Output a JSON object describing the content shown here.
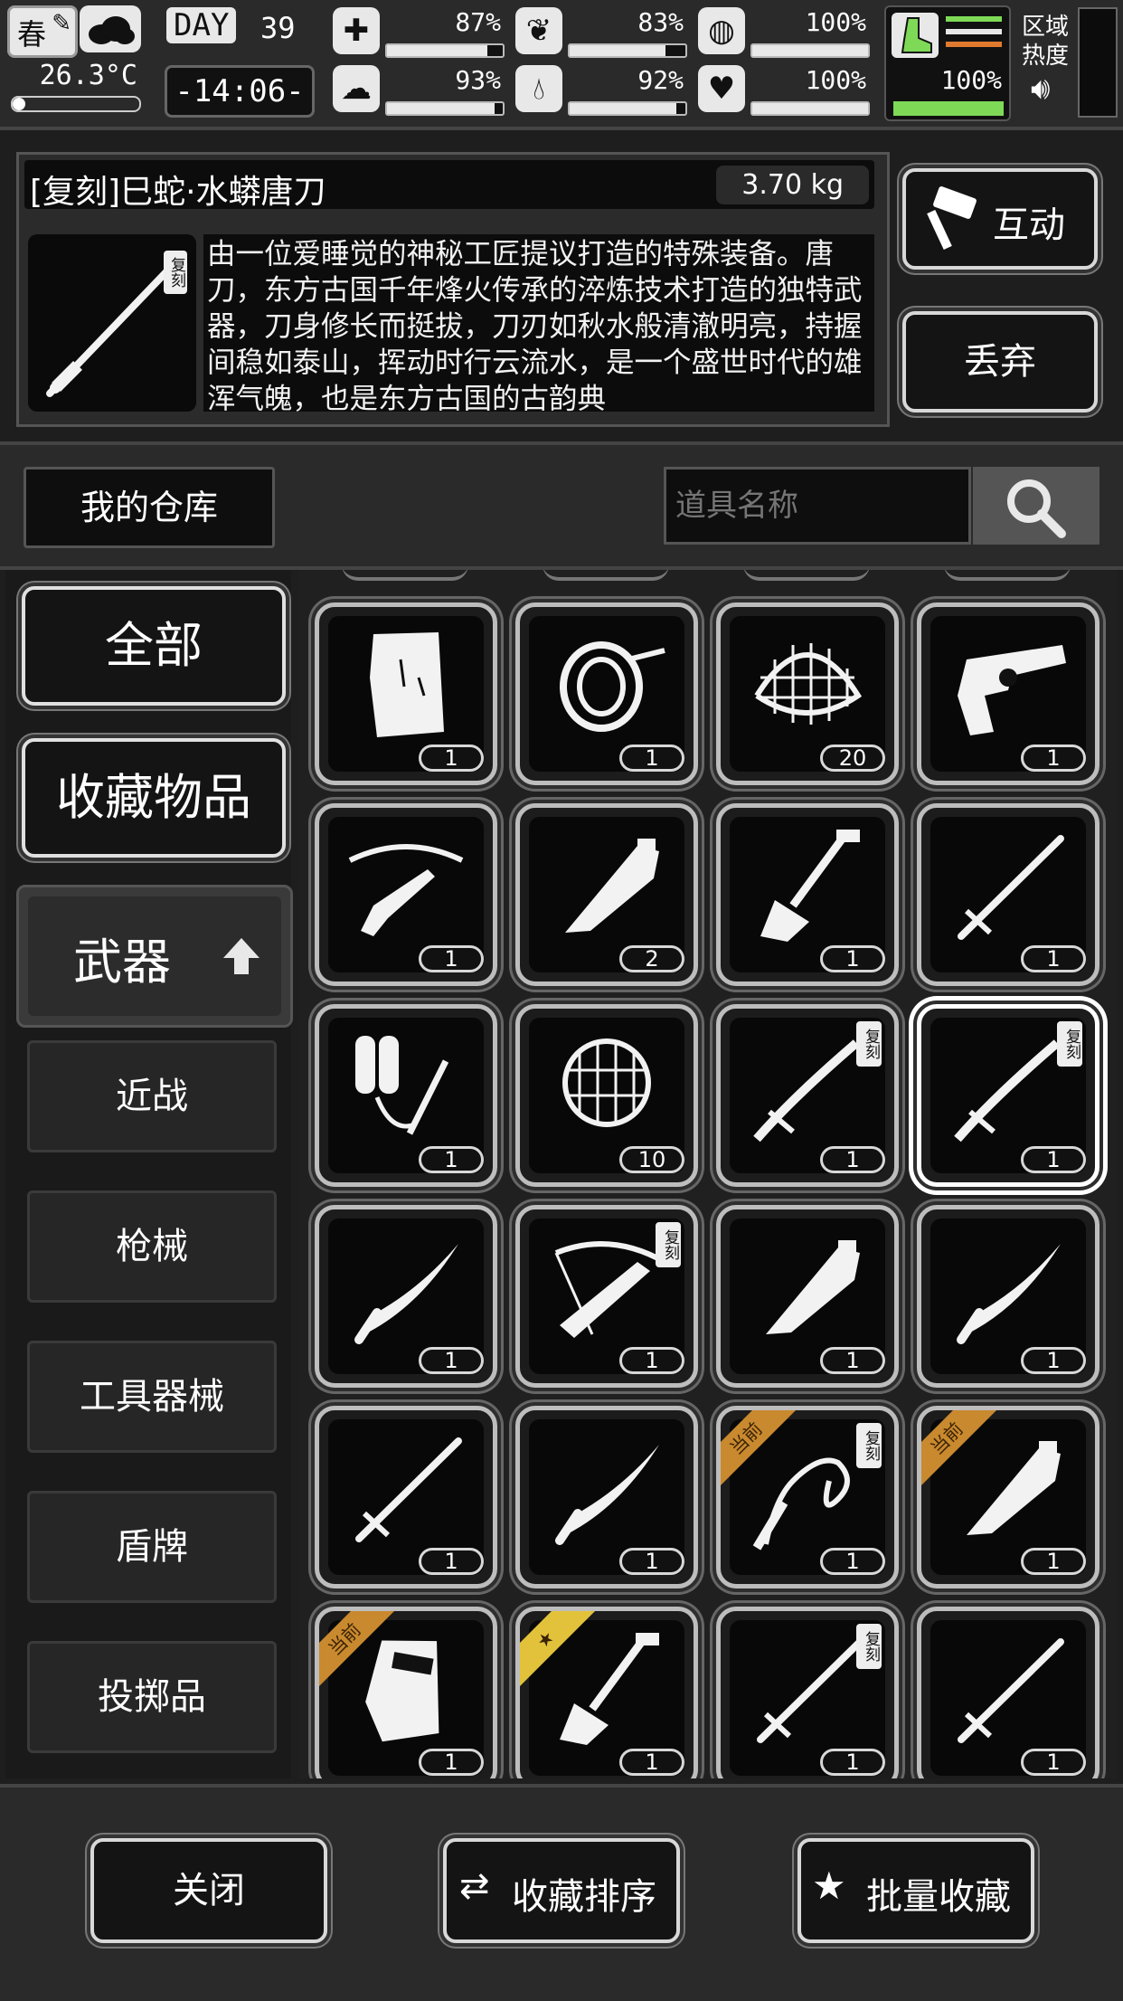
{
  "status": {
    "season": "春",
    "temperature": "26.3°C",
    "day_label": "DAY",
    "day_number": "39",
    "time": "-14:06-",
    "stats": [
      {
        "name": "health",
        "icon": "first-aid-kit-icon",
        "value": "87%",
        "level": 0.87
      },
      {
        "name": "hunger",
        "icon": "stomach-icon",
        "value": "83%",
        "level": 0.83
      },
      {
        "name": "stamina",
        "icon": "lung-icon",
        "value": "100%",
        "level": 1.0
      },
      {
        "name": "sanity",
        "icon": "brain-icon",
        "value": "93%",
        "level": 0.93
      },
      {
        "name": "thirst",
        "icon": "water-drop-icon",
        "value": "92%",
        "level": 0.92
      },
      {
        "name": "mood",
        "icon": "heart-icon",
        "value": "100%",
        "level": 1.0
      }
    ],
    "foot_value": "100%",
    "region_heat_label": "区域热度",
    "accent_green": "#7ed957",
    "accent_orange": "#e07a2e"
  },
  "item": {
    "name": "[复刻]巳蛇·水蟒唐刀",
    "weight": "3.70 kg",
    "tag": "复刻",
    "description": "由一位爱睡觉的神秘工匠提议打造的特殊装备。唐刀，东方古国千年烽火传承的淬炼技术打造的独特武器，刀身修长而挺拔，刀刃如秋水般清澈明亮，持握间稳如泰山，挥动时行云流水，是一个盛世时代的雄浑气魄，也是东方古国的古韵典",
    "interact_label": "互动",
    "discard_label": "丢弃"
  },
  "warehouse": {
    "title": "我的仓库",
    "search_placeholder": "道具名称"
  },
  "categories": {
    "all": "全部",
    "favorites": "收藏物品",
    "weapons": "武器",
    "sub": [
      "近战",
      "枪械",
      "工具器械",
      "盾牌",
      "投掷品"
    ]
  },
  "grid": [
    {
      "icon": "paper-map-icon",
      "count": "1"
    },
    {
      "icon": "rope-coil-icon",
      "count": "1"
    },
    {
      "icon": "fishing-net-icon",
      "count": "20"
    },
    {
      "icon": "revolver-icon",
      "count": "1"
    },
    {
      "icon": "crossbow-hand-icon",
      "count": "1"
    },
    {
      "icon": "machete-icon",
      "count": "2"
    },
    {
      "icon": "shovel-icon",
      "count": "1"
    },
    {
      "icon": "serrated-knife-icon",
      "count": "1"
    },
    {
      "icon": "flamethrower-icon",
      "count": "1"
    },
    {
      "icon": "net-bag-icon",
      "count": "10"
    },
    {
      "icon": "ornate-sword-icon",
      "count": "1",
      "tag": "复刻"
    },
    {
      "icon": "tang-dao-icon",
      "count": "1",
      "tag": "复刻",
      "selected": true
    },
    {
      "icon": "folding-knife-icon",
      "count": "1"
    },
    {
      "icon": "crossbow-icon",
      "count": "1",
      "tag": "复刻"
    },
    {
      "icon": "cleaver-icon",
      "count": "1"
    },
    {
      "icon": "curved-knife-icon",
      "count": "1"
    },
    {
      "icon": "machete-blade-icon",
      "count": "1"
    },
    {
      "icon": "sabre-icon",
      "count": "1"
    },
    {
      "icon": "whip-icon",
      "count": "1",
      "tag": "复刻",
      "ribbon": "当前"
    },
    {
      "icon": "meat-cleaver-icon",
      "count": "1",
      "ribbon": "当前"
    },
    {
      "icon": "riot-shield-icon",
      "count": "1",
      "ribbon": "当前"
    },
    {
      "icon": "spade-icon",
      "count": "1",
      "ribbon": "★"
    },
    {
      "icon": "katana-icon",
      "count": "1",
      "tag": "复刻"
    },
    {
      "icon": "long-sword-icon",
      "count": "1"
    }
  ],
  "footer": {
    "close": "关闭",
    "sort": "收藏排序",
    "batch": "批量收藏"
  }
}
